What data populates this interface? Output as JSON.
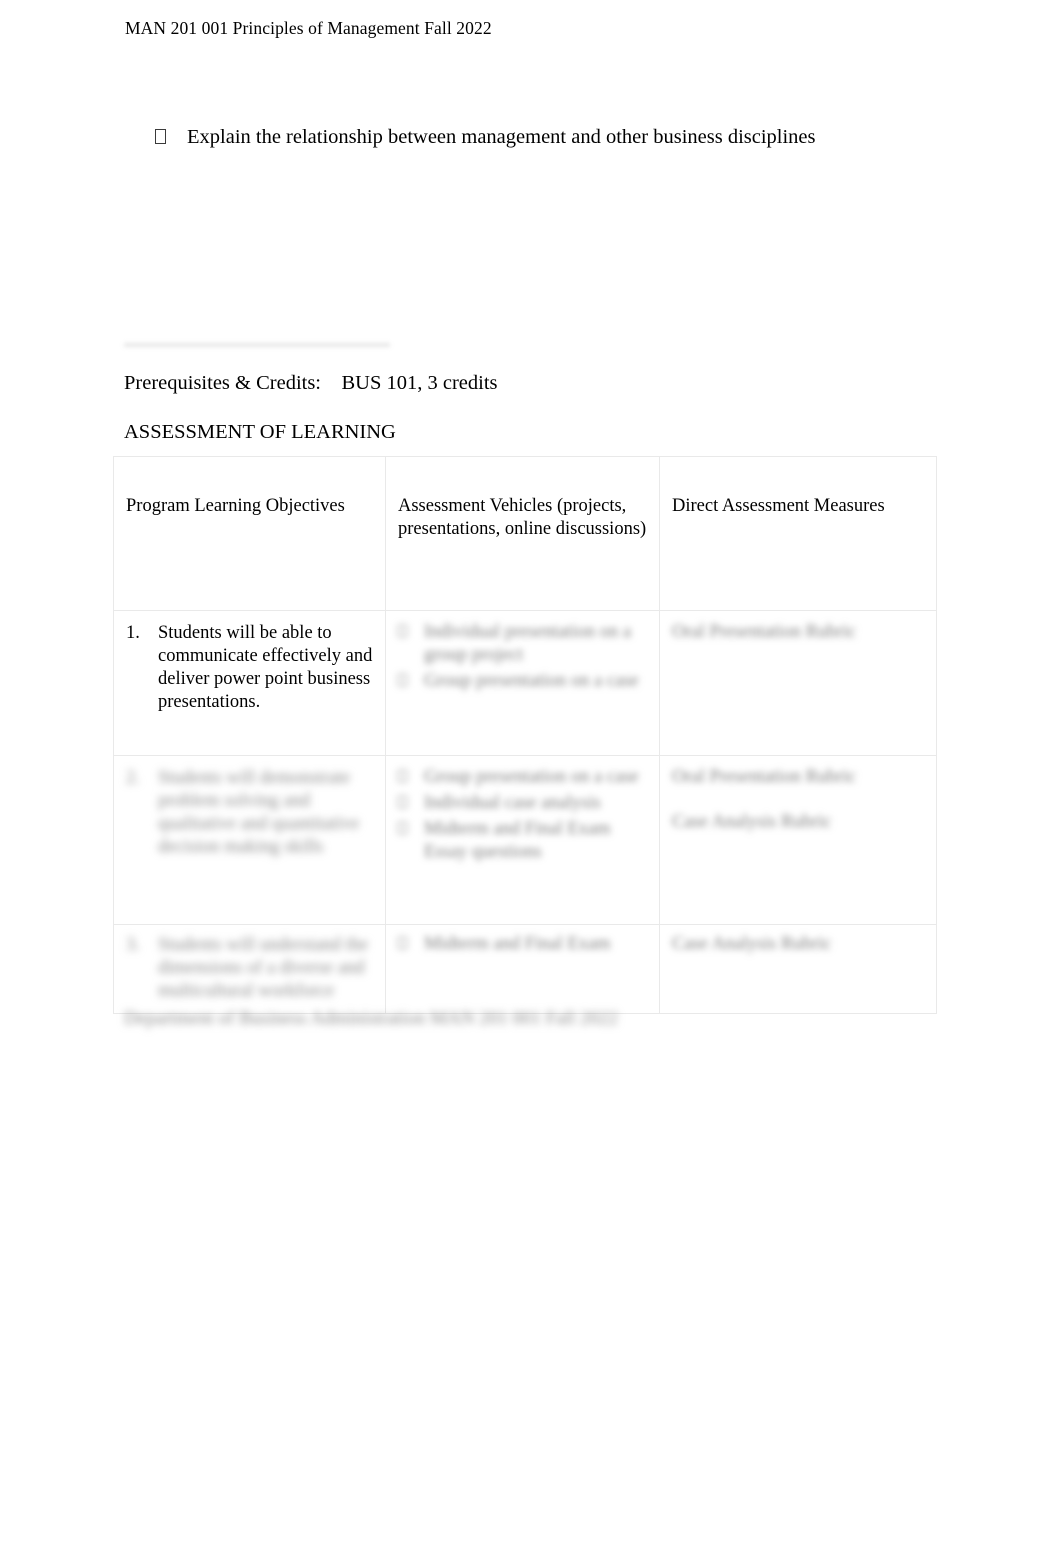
{
  "document": {
    "running_header": "MAN 201 001 Principles of Management Fall 2022",
    "bullet_marker": "□",
    "bullet_text": "Explain the relationship between management and other business disciplines",
    "prerequisites_line": "Prerequisites & Credits:    BUS 101, 3 credits",
    "section_heading": "ASSESSMENT OF LEARNING",
    "footer_note": "Department of Business Administration MAN 201 001 Fall 2022"
  },
  "table": {
    "headers": [
      "Program Learning Objectives",
      "Assessment Vehicles (projects, presentations, online discussions)",
      "Direct Assessment Measures"
    ],
    "rows": [
      {
        "number": "1.",
        "objective": "Students will be able to communicate effectively and deliver power point business presentations.",
        "objective_redacted": false,
        "vehicles": [
          "Individual presentation on a group project",
          "Group presentation on a case"
        ],
        "vehicles_redacted": true,
        "measures": [
          "Oral Presentation Rubric"
        ],
        "measures_redacted": true
      },
      {
        "number": "2.",
        "objective": "Students will demonstrate problem solving and qualitative and quantitative decision making skills",
        "objective_redacted": true,
        "vehicles": [
          "Group presentation on a case",
          "Individual case analysis",
          "Midterm and Final Exam Essay questions"
        ],
        "vehicles_redacted": true,
        "measures": [
          "Oral Presentation Rubric",
          "Case Analysis Rubric"
        ],
        "measures_redacted": true
      },
      {
        "number": "3.",
        "objective": "Students will understand the dimensions of a diverse and multicultural workforce",
        "objective_redacted": true,
        "vehicles": [
          "Midterm and Final Exam"
        ],
        "vehicles_redacted": true,
        "measures": [
          "Case Analysis Rubric"
        ],
        "measures_redacted": true
      }
    ]
  }
}
